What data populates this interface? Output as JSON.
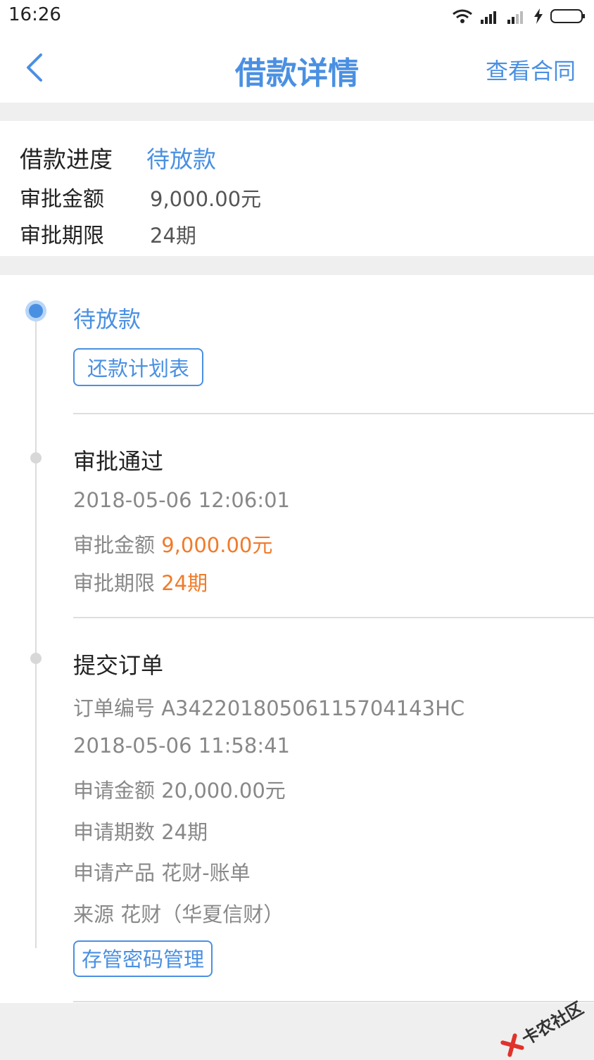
{
  "status_bar": {
    "time": "16:26"
  },
  "nav": {
    "title": "借款详情",
    "action": "查看合同"
  },
  "summary": {
    "progress_label": "借款进度",
    "progress_value": "待放款",
    "amount_label": "审批金额",
    "amount_value": "9,000.00元",
    "term_label": "审批期限",
    "term_value": "24期"
  },
  "timeline": {
    "step1": {
      "title": "待放款",
      "button": "还款计划表"
    },
    "step2": {
      "title": "审批通过",
      "time": "2018-05-06 12:06:01",
      "amount_label": "审批金额",
      "amount_value": "9,000.00元",
      "term_label": "审批期限",
      "term_value": "24期"
    },
    "step3": {
      "title": "提交订单",
      "order_no": "订单编号  A34220180506115704143HC",
      "time": "2018-05-06 11:58:41",
      "apply_amount": "申请金额 20,000.00元",
      "apply_term": "申请期数 24期",
      "apply_product": "申请产品  花财-账单",
      "source": "来源  花财（华夏信财）",
      "button": "存管密码管理"
    }
  },
  "watermark": {
    "text": "卡农社区"
  },
  "colors": {
    "primary": "#4a90e2",
    "highlight": "#f07b2a"
  }
}
